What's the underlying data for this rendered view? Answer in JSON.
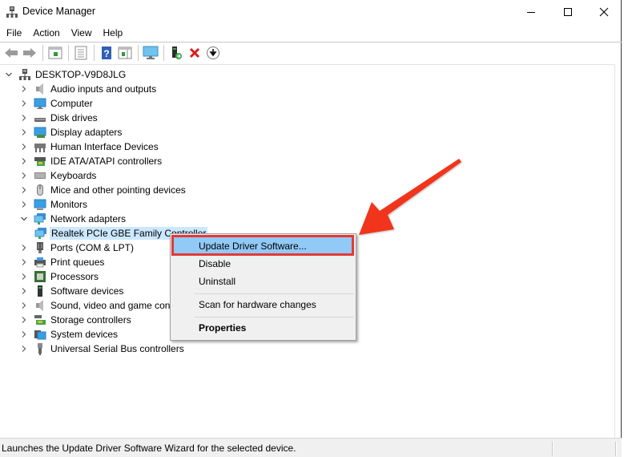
{
  "window": {
    "title": "Device Manager",
    "controls": {
      "minimize": "minimize",
      "maximize": "maximize",
      "close": "close"
    }
  },
  "menubar": {
    "items": [
      "File",
      "Action",
      "View",
      "Help"
    ]
  },
  "toolbar": {
    "buttons": [
      {
        "name": "back",
        "icon": "back-arrow-icon"
      },
      {
        "name": "forward",
        "icon": "forward-arrow-icon"
      },
      {
        "name": "show-hide-console-tree",
        "icon": "console-tree-icon"
      },
      {
        "name": "properties",
        "icon": "properties-sheet-icon"
      },
      {
        "name": "help",
        "icon": "help-icon"
      },
      {
        "name": "action-pane",
        "icon": "action-pane-icon"
      },
      {
        "name": "scan-hardware",
        "icon": "monitor-scan-icon"
      },
      {
        "name": "update-driver",
        "icon": "update-driver-icon"
      },
      {
        "name": "uninstall",
        "icon": "red-x-icon"
      },
      {
        "name": "disable",
        "icon": "down-arrow-circle-icon"
      }
    ]
  },
  "tree": {
    "root": {
      "label": "DESKTOP-V9D8JLG",
      "expanded": true
    },
    "categories": [
      {
        "label": "Audio inputs and outputs",
        "icon": "speaker-icon",
        "expanded": false
      },
      {
        "label": "Computer",
        "icon": "computer-icon",
        "expanded": false
      },
      {
        "label": "Disk drives",
        "icon": "disk-drive-icon",
        "expanded": false
      },
      {
        "label": "Display adapters",
        "icon": "display-adapter-icon",
        "expanded": false
      },
      {
        "label": "Human Interface Devices",
        "icon": "hid-icon",
        "expanded": false
      },
      {
        "label": "IDE ATA/ATAPI controllers",
        "icon": "ide-controller-icon",
        "expanded": false
      },
      {
        "label": "Keyboards",
        "icon": "keyboard-icon",
        "expanded": false
      },
      {
        "label": "Mice and other pointing devices",
        "icon": "mouse-icon",
        "expanded": false
      },
      {
        "label": "Monitors",
        "icon": "monitor-icon",
        "expanded": false
      },
      {
        "label": "Network adapters",
        "icon": "network-adapter-icon",
        "expanded": true
      },
      {
        "label": "Ports (COM & LPT)",
        "icon": "port-icon",
        "expanded": false
      },
      {
        "label": "Print queues",
        "icon": "printer-icon",
        "expanded": false
      },
      {
        "label": "Processors",
        "icon": "processor-icon",
        "expanded": false
      },
      {
        "label": "Software devices",
        "icon": "software-device-icon",
        "expanded": false
      },
      {
        "label": "Sound, video and game controllers",
        "icon": "sound-icon",
        "expanded": false
      },
      {
        "label": "Storage controllers",
        "icon": "storage-controller-icon",
        "expanded": false
      },
      {
        "label": "System devices",
        "icon": "system-device-icon",
        "expanded": false
      },
      {
        "label": "Universal Serial Bus controllers",
        "icon": "usb-icon",
        "expanded": false
      }
    ],
    "network_child": {
      "label": "Realtek PCIe GBE Family Controller",
      "selected": true
    }
  },
  "context_menu": {
    "items": [
      {
        "label": "Update Driver Software...",
        "highlighted": true
      },
      {
        "label": "Disable"
      },
      {
        "label": "Uninstall"
      },
      {
        "label": "Scan for hardware changes"
      },
      {
        "label": "Properties",
        "bold": true
      }
    ],
    "annotation_color": "#e53935",
    "highlight_color": "#91c9f7"
  },
  "statusbar": {
    "text": "Launches the Update Driver Software Wizard for the selected device."
  },
  "colors": {
    "selection": "#cce8ff",
    "arrow": "#f0361f"
  }
}
